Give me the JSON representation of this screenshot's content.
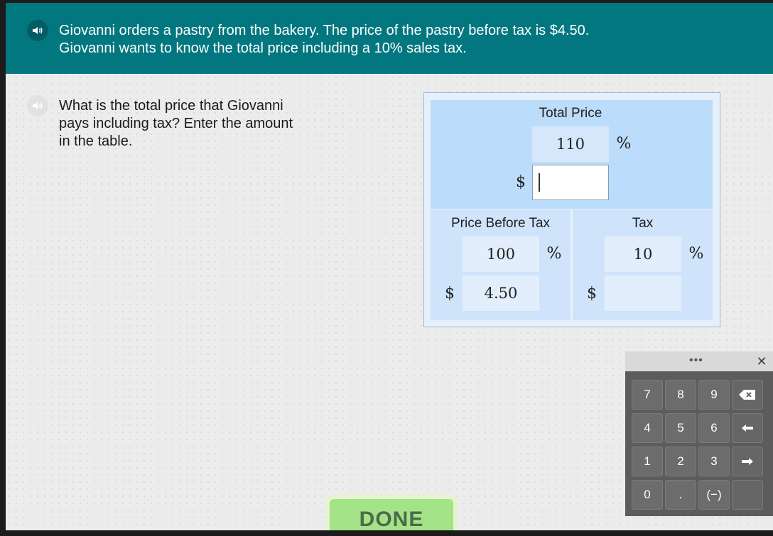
{
  "header": {
    "line1": "Giovanni orders a pastry from the bakery. The price of the pastry before tax is $4.50.",
    "line2": "Giovanni wants to know the total price including a 10% sales tax."
  },
  "question": {
    "line1": "What is the total price that Giovanni",
    "line2": "pays including tax? Enter the amount",
    "line3": "in the table."
  },
  "table": {
    "total": {
      "label": "Total Price",
      "percent_value": "110",
      "percent_sign": "%",
      "dollar_sign": "$",
      "dollar_value": ""
    },
    "price_before_tax": {
      "label": "Price Before Tax",
      "percent_value": "100",
      "percent_sign": "%",
      "dollar_sign": "$",
      "dollar_value": "4.50"
    },
    "tax": {
      "label": "Tax",
      "percent_value": "10",
      "percent_sign": "%",
      "dollar_sign": "$",
      "dollar_value": ""
    }
  },
  "keypad": {
    "dots": "•••",
    "close": "✕",
    "keys": {
      "k7": "7",
      "k8": "8",
      "k9": "9",
      "k4": "4",
      "k5": "5",
      "k6": "6",
      "k1": "1",
      "k2": "2",
      "k3": "3",
      "k0": "0",
      "dot": ".",
      "neg": "(−)"
    },
    "icons": {
      "backspace": "backspace-icon",
      "left": "arrow-left-icon",
      "right": "arrow-right-icon"
    }
  },
  "done_label": "DONE",
  "colors": {
    "header_bg": "#03777f",
    "table_bg": "#bcdcfb",
    "done_bg": "#a4e388",
    "keypad_bg": "#5c5c5c"
  }
}
